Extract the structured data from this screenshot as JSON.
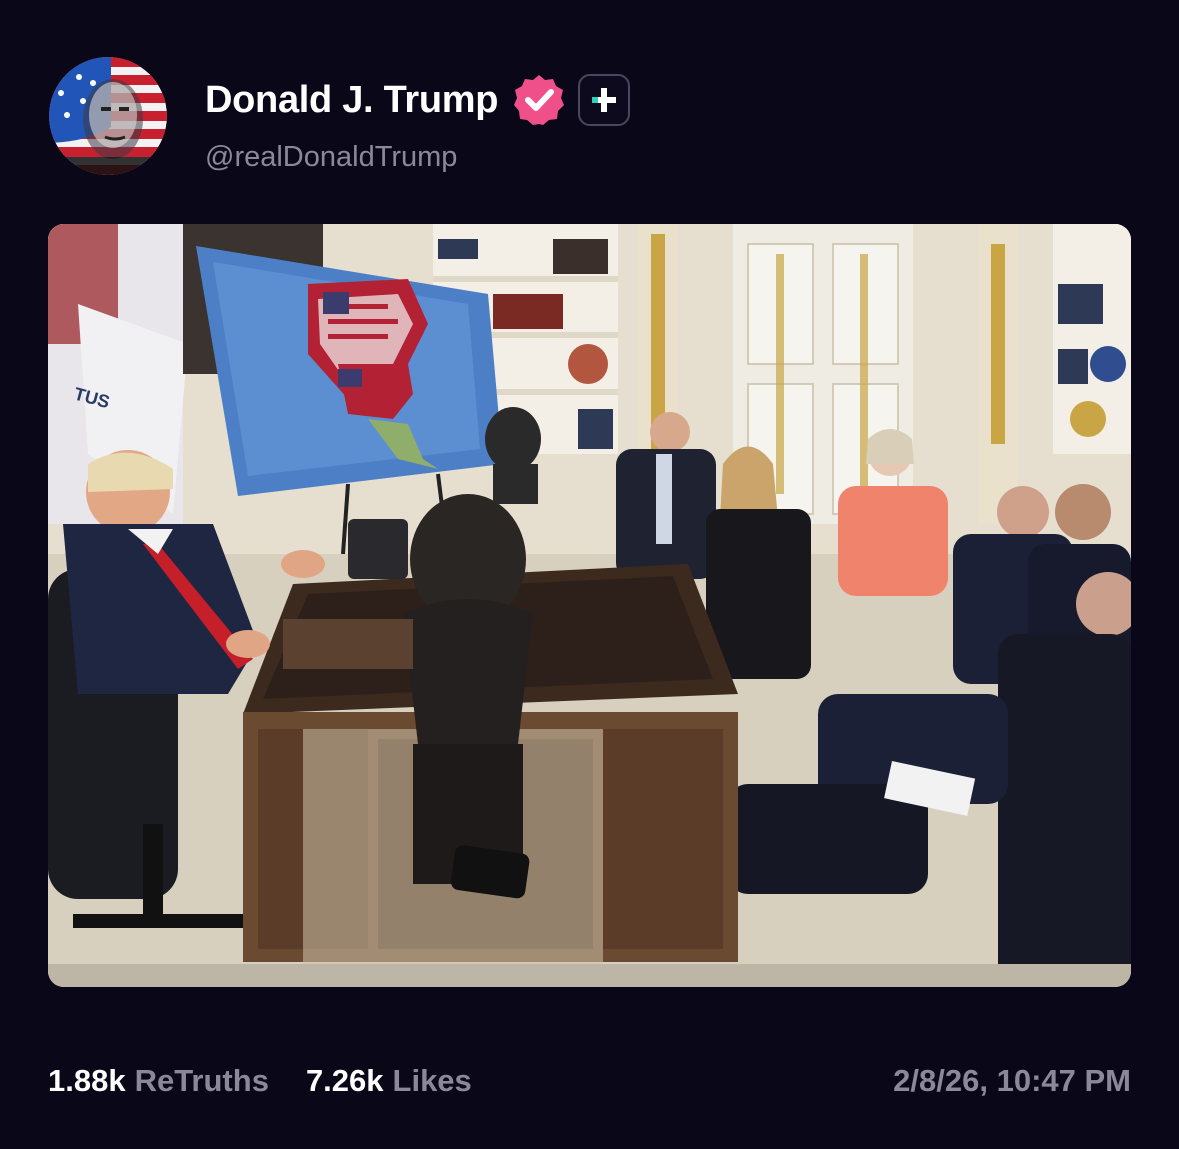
{
  "post": {
    "author": {
      "display_name": "Donald J. Trump",
      "handle": "@realDonaldTrump",
      "avatar_icon": "flag-portrait-avatar",
      "verified_icon": "verified-badge-icon",
      "verified_color": "#f0508a",
      "plus_icon": "plus-follow-icon",
      "plus_accent": "#2ed3b7"
    },
    "media": {
      "kind": "photo"
    },
    "stats": {
      "retruths_count": "1.88k",
      "retruths_label": "ReTruths",
      "likes_count": "7.26k",
      "likes_label": "Likes"
    },
    "timestamp": "2/8/26, 10:47 PM"
  },
  "theme": {
    "background": "#0a0718",
    "text_primary": "#ffffff",
    "text_secondary": "#8b8998"
  }
}
